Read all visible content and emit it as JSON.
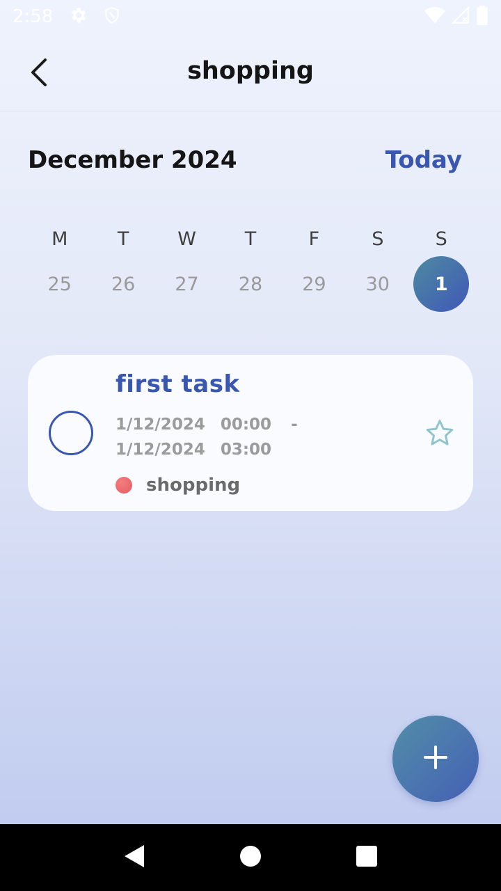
{
  "status_bar": {
    "time": "2:58",
    "icons": [
      "gear-icon",
      "shield-icon",
      "wifi-icon",
      "signal-icon",
      "battery-icon"
    ]
  },
  "appbar": {
    "title": "shopping",
    "back_icon": "chevron-left-icon"
  },
  "calendar": {
    "month": "December 2024",
    "today_label": "Today",
    "weekdays": [
      "M",
      "T",
      "W",
      "T",
      "F",
      "S",
      "S"
    ],
    "dates": [
      "25",
      "26",
      "27",
      "28",
      "29",
      "30",
      "1"
    ],
    "selected_index": 6
  },
  "task": {
    "title": "first task",
    "start_date": "1/12/2024",
    "start_time": "00:00",
    "separator": "-",
    "end_date": "1/12/2024",
    "end_time": "03:00",
    "category": "shopping",
    "category_color": "#ef6f74",
    "starred": false
  },
  "fab": {
    "icon": "plus-icon"
  },
  "colors": {
    "accent": "#3a57b0",
    "gradient_start": "#4c8aa0",
    "gradient_end": "#4158b8",
    "star_outline": "#8fc4cc"
  },
  "nav": {
    "icons": [
      "nav-back-icon",
      "nav-home-icon",
      "nav-recents-icon"
    ]
  }
}
